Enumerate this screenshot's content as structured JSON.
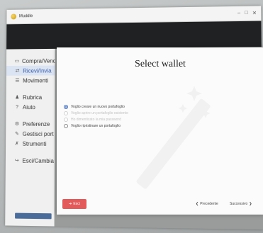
{
  "window": {
    "title": "Muddle"
  },
  "sidebar": {
    "items": [
      {
        "label": "Compra/Vend",
        "icon": "monitor-icon",
        "glyph": "▭"
      },
      {
        "label": "Ricevi/Invia",
        "icon": "transfer-icon",
        "glyph": "⇄"
      },
      {
        "label": "Movimenti",
        "icon": "list-icon",
        "glyph": "☰"
      },
      {
        "label": "Rubrica",
        "icon": "person-icon",
        "glyph": "♟"
      },
      {
        "label": "Aiuto",
        "icon": "question-icon",
        "glyph": "?"
      },
      {
        "label": "Preferenze",
        "icon": "gear-icon",
        "glyph": "⚙"
      },
      {
        "label": "Gestisci port",
        "icon": "edit-icon",
        "glyph": "✎"
      },
      {
        "label": "Strumenti",
        "icon": "wrench-icon",
        "glyph": "✗"
      },
      {
        "label": "Esci/Cambia",
        "icon": "exit-icon",
        "glyph": "↪"
      }
    ]
  },
  "modal": {
    "title": "Select wallet",
    "options": [
      {
        "label": "Voglio creare un nuovo portafoglio",
        "checked": true,
        "disabled": false
      },
      {
        "label": "Voglio aprire un portafoglio esistente",
        "checked": false,
        "disabled": true
      },
      {
        "label": "Ho dimenticato la mia password",
        "checked": false,
        "disabled": true
      },
      {
        "label": "Voglio ripristinare un portafoglio",
        "checked": false,
        "disabled": false
      }
    ],
    "exit_label": "Esci",
    "back_label": "Precedente",
    "next_label": "Successivo"
  },
  "colors": {
    "exit_button": "#e35a5a",
    "radio_checked": "#3a66c5",
    "topbar": "#1f2122"
  }
}
